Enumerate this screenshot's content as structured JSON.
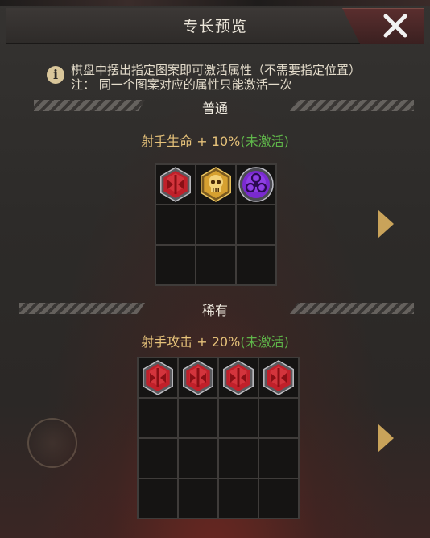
{
  "header": {
    "title": "专长预览"
  },
  "info": {
    "line1": "棋盘中摆出指定图案即可激活属性（不需要指定位置）",
    "line2": "注： 同一个图案对应的属性只能激活一次"
  },
  "sections": [
    {
      "title": "普通",
      "bonus_text": "射手生命 + 10%",
      "status": "(未激活)",
      "grid": [
        [
          "axe-red-icon",
          "skull-gold-icon",
          "biohazard-purple-icon"
        ],
        [
          "",
          "",
          ""
        ],
        [
          "",
          "",
          ""
        ]
      ]
    },
    {
      "title": "稀有",
      "bonus_text": "射手攻击 + 20%",
      "status": "(未激活)",
      "grid": [
        [
          "axe-red-icon",
          "axe-red-icon",
          "axe-red-icon",
          "axe-red-icon"
        ],
        [
          "",
          "",
          "",
          ""
        ],
        [
          "",
          "",
          "",
          ""
        ],
        [
          "",
          "",
          "",
          ""
        ]
      ]
    }
  ],
  "colors": {
    "accent_gold": "#e6c27a",
    "inactive_green": "#5fb54a",
    "text_light": "#f0ebe0"
  }
}
